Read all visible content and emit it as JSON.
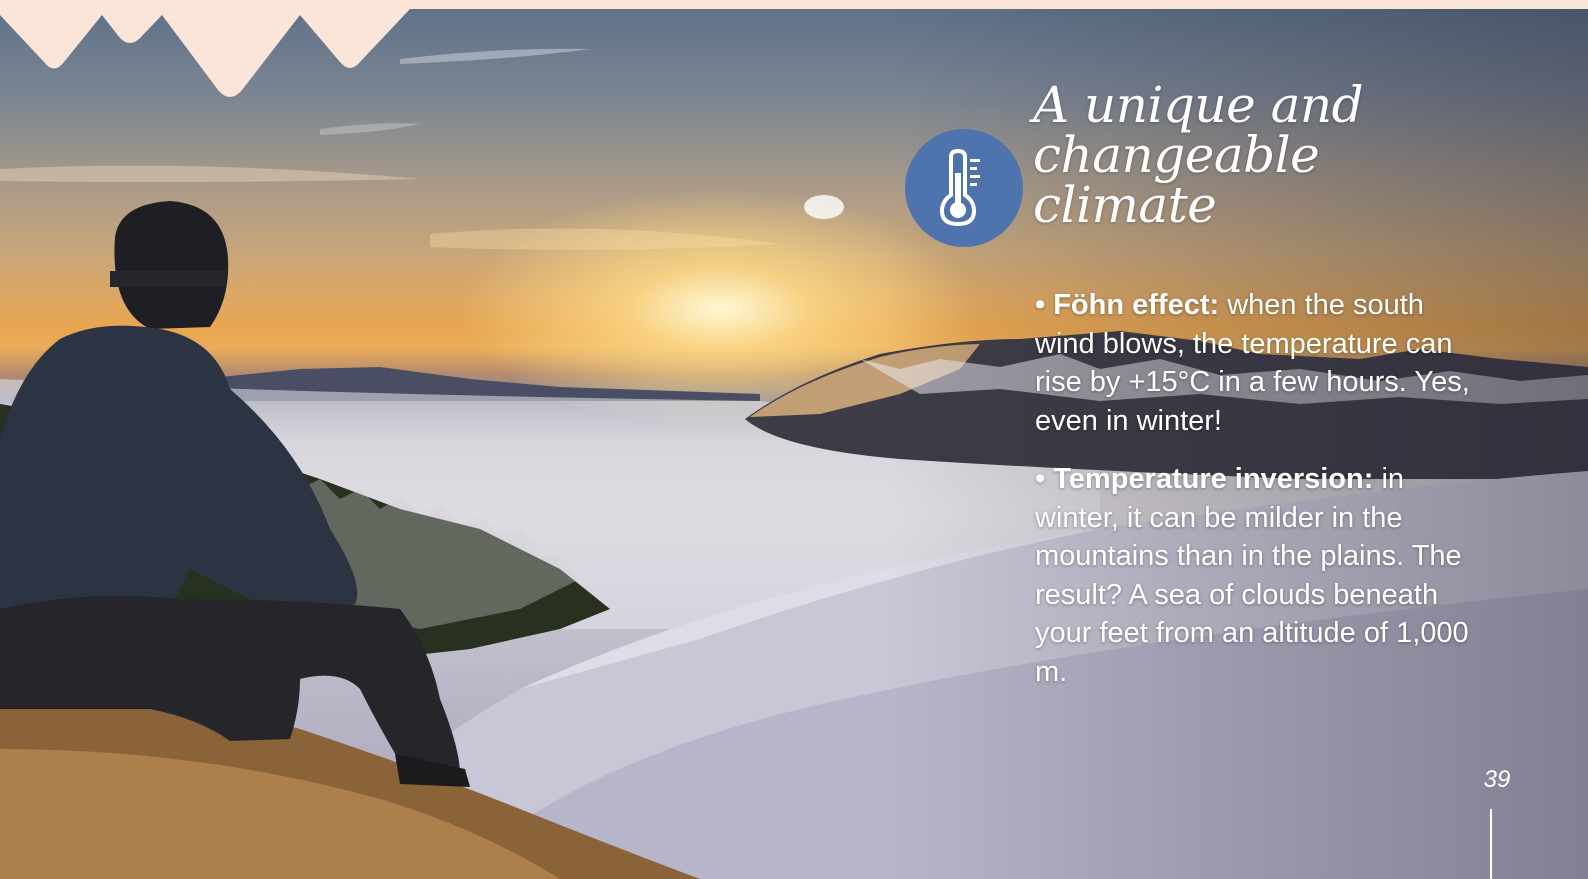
{
  "heading": {
    "lines": [
      "A unique and",
      "changeable",
      "climate"
    ]
  },
  "badge": {
    "icon": "thermometer-icon",
    "color": "#4e73ad"
  },
  "bullets": [
    {
      "marker": "•",
      "term": "Föhn effect:",
      "text": " when the south wind blows, the temperature can rise by +15°C in a few hours. Yes, even in winter!"
    },
    {
      "marker": "•",
      "term": "Temperature inversion:",
      "text": " in winter, it can be milder in the mountains than in the plains. The result? A sea of clouds beneath your feet from an altitude of 1,000 m."
    }
  ],
  "page_number": "39",
  "colors": {
    "band": "#fbe4d8",
    "accent": "#4e73ad",
    "text": "#ffffff"
  }
}
